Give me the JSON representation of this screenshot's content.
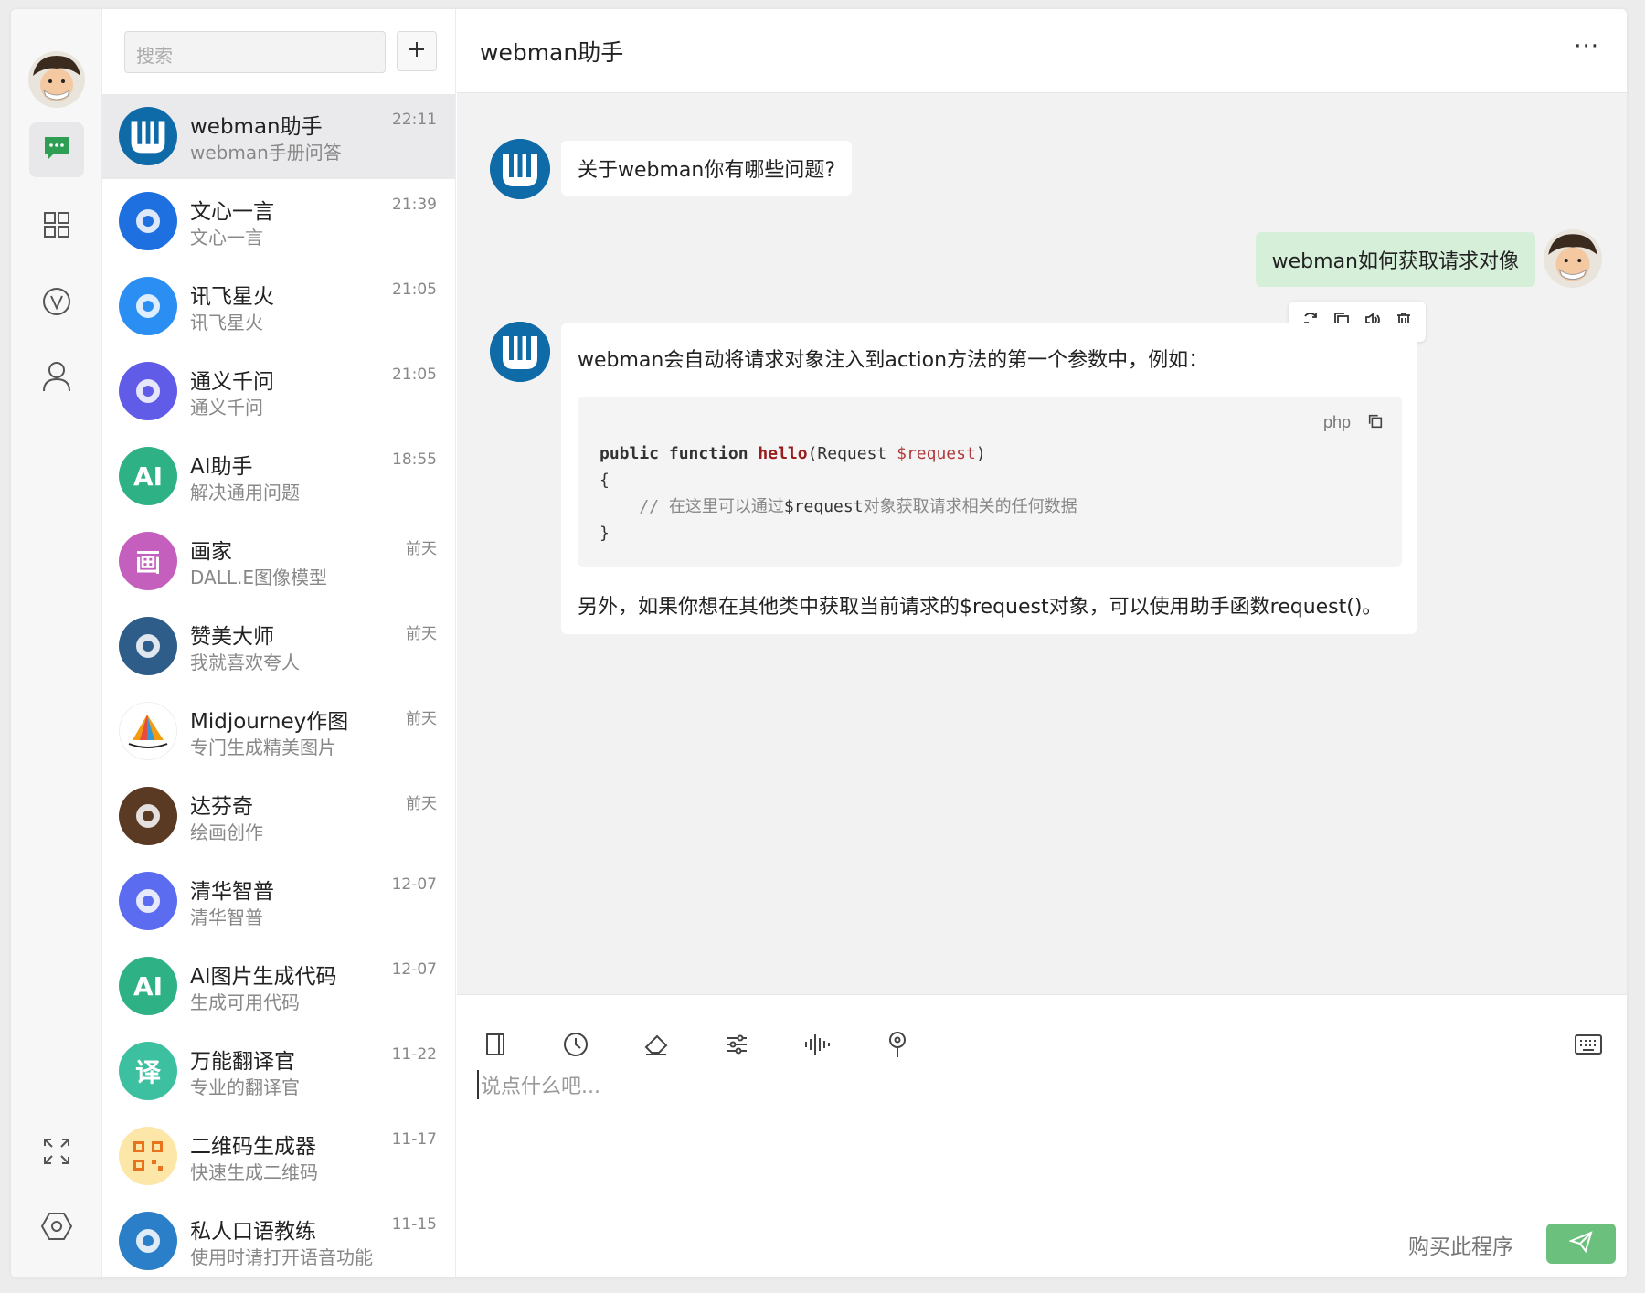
{
  "search": {
    "placeholder": "搜索"
  },
  "chats": [
    {
      "name": "webman助手",
      "sub": "webman手册问答",
      "time": "22:11",
      "avatar": "webman-logo",
      "color": "#0f6aa8"
    },
    {
      "name": "文心一言",
      "sub": "文心一言",
      "time": "21:39",
      "avatar": "ernie-logo",
      "color": "#1e6fe0"
    },
    {
      "name": "讯飞星火",
      "sub": "讯飞星火",
      "time": "21:05",
      "avatar": "spark-logo",
      "color": "#2b8ef2"
    },
    {
      "name": "通义千问",
      "sub": "通义千问",
      "time": "21:05",
      "avatar": "qwen-logo",
      "color": "#615ce8"
    },
    {
      "name": "AI助手",
      "sub": "解决通用问题",
      "time": "18:55",
      "avatar": "ai-logo",
      "color": "#2eb185",
      "label": "AI"
    },
    {
      "name": "画家",
      "sub": "DALL.E图像模型",
      "time": "前天",
      "avatar": "painter-logo",
      "color": "#c45fbe",
      "label": "画"
    },
    {
      "name": "赞美大师",
      "sub": "我就喜欢夸人",
      "time": "前天",
      "avatar": "praise-avatar",
      "color": "#2f5d8a"
    },
    {
      "name": "Midjourney作图",
      "sub": "专门生成精美图片",
      "time": "前天",
      "avatar": "midjourney-logo",
      "color": "#ffffff"
    },
    {
      "name": "达芬奇",
      "sub": "绘画创作",
      "time": "前天",
      "avatar": "davinci-avatar",
      "color": "#5a3a22"
    },
    {
      "name": "清华智普",
      "sub": "清华智普",
      "time": "12-07",
      "avatar": "zhipu-logo",
      "color": "#5c6cf0"
    },
    {
      "name": "AI图片生成代码",
      "sub": "生成可用代码",
      "time": "12-07",
      "avatar": "ai-logo",
      "color": "#2eb185",
      "label": "AI"
    },
    {
      "name": "万能翻译官",
      "sub": "专业的翻译官",
      "time": "11-22",
      "avatar": "translate-logo",
      "color": "#3cc0a0",
      "label": "译"
    },
    {
      "name": "二维码生成器",
      "sub": "快速生成二维码",
      "time": "11-17",
      "avatar": "qrcode-logo",
      "color": "#fde7a8"
    },
    {
      "name": "私人口语教练",
      "sub": "使用时请打开语音功能",
      "time": "11-15",
      "avatar": "coach-avatar",
      "color": "#2b7fc8"
    }
  ],
  "header": {
    "title": "webman助手",
    "more": "···"
  },
  "messages": {
    "bot_greeting": "关于webman你有哪些问题?",
    "user_question": "webman如何获取请求对像",
    "bot_answer_intro": "webman会自动将请求对象注入到action方法的第一个参数中，例如：",
    "code_lang": "php",
    "code": {
      "kw": "public function ",
      "fn": "hello",
      "p1": "(Request ",
      "var": "$request",
      "p2": ")",
      "open": "{",
      "comment_a": "// 在这里可以通过",
      "comment_var": "$request",
      "comment_b": "对象获取请求相关的任何数据",
      "close": "}"
    },
    "bot_answer_outro": "另外，如果你想在其他类中获取当前请求的$request对象，可以使用助手函数request()。"
  },
  "composer": {
    "placeholder": "说点什么吧...",
    "buy_label": "购买此程序"
  },
  "colors": {
    "accent": "#6cc07d",
    "user_bubble": "#d5efd9",
    "rail_chat_icon": "#2e9e55"
  }
}
